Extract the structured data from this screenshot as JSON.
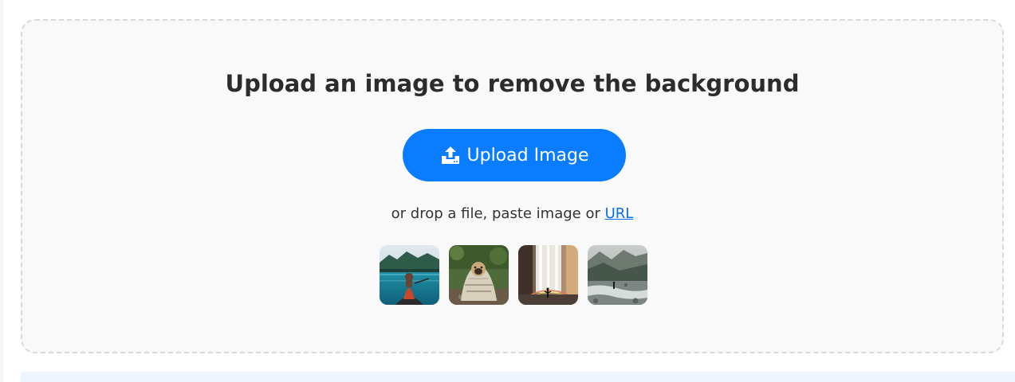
{
  "uploader": {
    "title": "Upload an image to remove the background",
    "upload_button_label": "Upload Image",
    "hint_prefix": "or drop a file, paste image or ",
    "hint_link": "URL"
  },
  "samples": [
    {
      "name": "woman-in-canoe-on-lake"
    },
    {
      "name": "dog-wrapped-in-blanket"
    },
    {
      "name": "person-at-waterfall"
    },
    {
      "name": "person-by-mountain-river"
    }
  ],
  "colors": {
    "accent": "#0a7cff",
    "link": "#0a6fe8",
    "drop_zone_bg": "#f9f9f9",
    "drop_zone_border": "#d9d9d9",
    "title_text": "#2c2c2c"
  }
}
